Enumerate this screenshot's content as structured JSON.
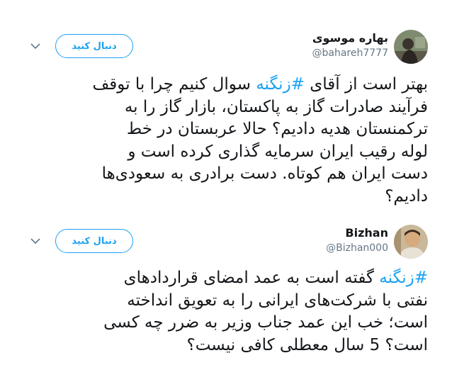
{
  "tweets": [
    {
      "display_name": "بهاره موسوی",
      "handle": "@bahareh7777",
      "follow_label": "دنبال کنید",
      "lines": [
        {
          "before": "بهتر است از آقای ",
          "tag": "#زنگنه",
          "after": " سوال کنیم چرا با توقف"
        },
        {
          "before": "فرآیند صادرات گاز به پاکستان، بازار گاز را به",
          "tag": "",
          "after": ""
        },
        {
          "before": "ترکمنستان هدیه دادیم؟ حالا عربستان در خط",
          "tag": "",
          "after": ""
        },
        {
          "before": "لوله رقیب ایران سرمایه گذاری کرده است و",
          "tag": "",
          "after": ""
        },
        {
          "before": "دست ایران هم کوتاه. دست برادری به سعودی‌ها",
          "tag": "",
          "after": ""
        },
        {
          "before": "دادیم؟",
          "tag": "",
          "after": ""
        }
      ]
    },
    {
      "display_name": "Bizhan",
      "handle": "@Bizhan000",
      "follow_label": "دنبال کنید",
      "lines": [
        {
          "before": "",
          "tag": "#زنگنه",
          "after": " گفته است به عمد امضای قراردادهای"
        },
        {
          "before": "نفتی با شرکت‌های ایرانی را به تعویق انداخته",
          "tag": "",
          "after": ""
        },
        {
          "before": "است؛ خب این عمد جناب وزیر به ضرر چه کسی",
          "tag": "",
          "after": ""
        },
        {
          "before": "است؟ 5 سال معطلی کافی نیست؟",
          "tag": "",
          "after": ""
        }
      ]
    }
  ],
  "icons": {
    "caret": "chevron-down-icon",
    "avatar": "avatar"
  },
  "colors": {
    "accent": "#1da1f2",
    "text": "#14171a",
    "muted": "#657786"
  }
}
